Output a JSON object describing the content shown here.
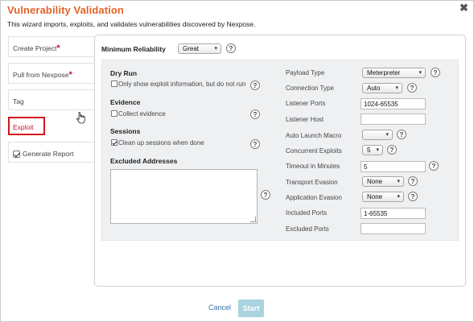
{
  "window": {
    "title": "Vulnerability Validation",
    "subtitle": "This wizard imports, exploits, and validates vulnerabilities discovered by Nexpose.",
    "close_glyph": "✖"
  },
  "steps": [
    {
      "label": "Create Project",
      "required": "*"
    },
    {
      "label": "Pull from Nexpose",
      "required": "*"
    },
    {
      "label": "Tag"
    },
    {
      "label": "Exploit",
      "active": true
    },
    {
      "label": "Generate Report",
      "checked": true
    }
  ],
  "min_reliability": {
    "label": "Minimum Reliability",
    "value": "Great",
    "help": "?"
  },
  "left": {
    "dry_run": {
      "heading": "Dry Run",
      "checkbox_label": "Only show exploit information, but do not run",
      "checked": false
    },
    "evidence": {
      "heading": "Evidence",
      "checkbox_label": "Collect evidence",
      "checked": false
    },
    "sessions": {
      "heading": "Sessions",
      "checkbox_label": "Clean up sessions when done",
      "checked": true
    },
    "excluded_addresses": {
      "heading": "Excluded Addresses",
      "value": ""
    }
  },
  "right": {
    "payload_type": {
      "label": "Payload Type",
      "value": "Meterpreter"
    },
    "connection_type": {
      "label": "Connection Type",
      "value": "Auto"
    },
    "listener_ports": {
      "label": "Listener Ports",
      "value": "1024-65535"
    },
    "listener_host": {
      "label": "Listener Host",
      "value": ""
    },
    "auto_launch_macro": {
      "label": "Auto Launch Macro",
      "value": ""
    },
    "concurrent_exploits": {
      "label": "Concurrent Exploits",
      "value": "5"
    },
    "timeout": {
      "label": "Timeout in Minutes",
      "value": "5"
    },
    "transport_evasion": {
      "label": "Transport Evasion",
      "value": "None"
    },
    "application_evasion": {
      "label": "Application Evasion",
      "value": "None"
    },
    "included_ports": {
      "label": "Included Ports",
      "value": "1-65535"
    },
    "excluded_ports": {
      "label": "Excluded Ports",
      "value": ""
    }
  },
  "footer": {
    "cancel_label": "Cancel",
    "start_label": "Start"
  },
  "colors": {
    "title": "#e2632a",
    "required_star": "#c8102e",
    "active_step_border": "#d4141b",
    "start_button": "#a9d3df",
    "link": "#3a6ea5"
  },
  "icons": {
    "dropdown": "▾",
    "help": "?",
    "close": "close-icon",
    "cursor": "hand-pointer-icon"
  }
}
